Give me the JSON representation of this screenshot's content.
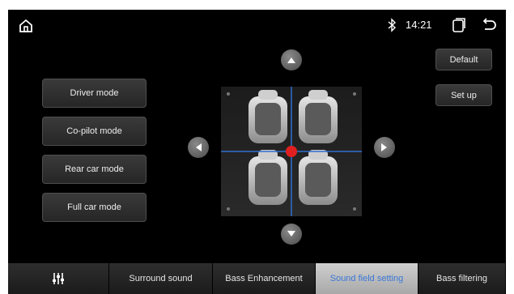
{
  "status_bar": {
    "time": "14:21"
  },
  "modes": [
    {
      "label": "Driver mode"
    },
    {
      "label": "Co-pilot mode"
    },
    {
      "label": "Rear car mode"
    },
    {
      "label": "Full car mode"
    }
  ],
  "side_buttons": {
    "default_label": "Default",
    "setup_label": "Set up"
  },
  "tabs": [
    {
      "label": "",
      "icon": "equalizer-icon"
    },
    {
      "label": "Surround sound"
    },
    {
      "label": "Bass Enhancement"
    },
    {
      "label": "Sound field setting",
      "active": true
    },
    {
      "label": "Bass filtering"
    }
  ],
  "colors": {
    "accent": "#3b78d8",
    "focus_dot": "#e02020",
    "crosshair": "#2f6fd0"
  }
}
